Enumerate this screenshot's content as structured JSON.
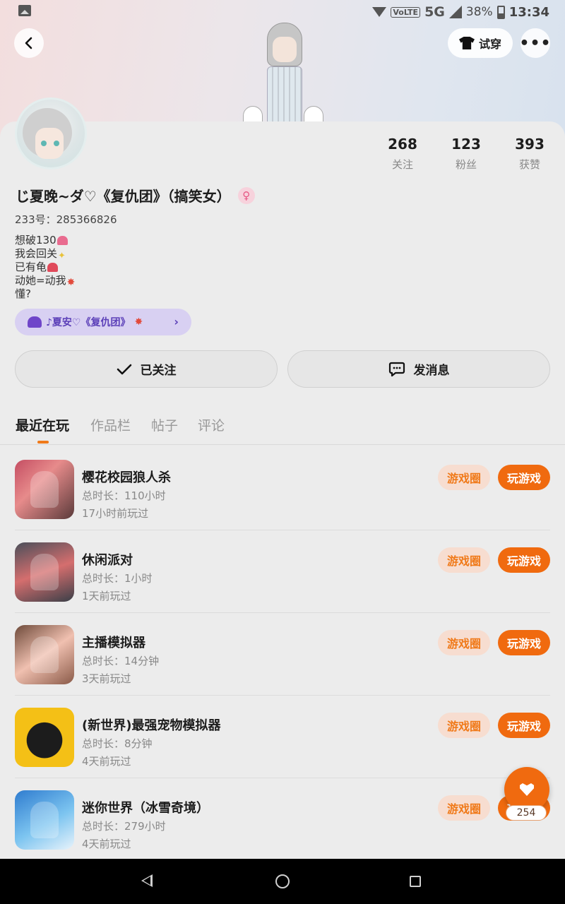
{
  "status_bar": {
    "network": "5G",
    "volte": "VoLTE",
    "battery": "38%",
    "time": "13:34"
  },
  "header": {
    "tryon_label": "试穿",
    "more_label": "•••"
  },
  "profile": {
    "stats": [
      {
        "value": "268",
        "label": "关注"
      },
      {
        "value": "123",
        "label": "粉丝"
      },
      {
        "value": "393",
        "label": "获赞"
      }
    ],
    "name": "じ夏晚~ダ♡《复仇团》（搞笑女）",
    "gender_icon": "female-icon",
    "uid": "233号：285366826",
    "bio_lines": [
      "想破130",
      "我会回关",
      "已有龟",
      "动她=动我",
      "懂?"
    ],
    "fan_badge": "♪夏安♡《复仇团》",
    "follow_label": "已关注",
    "message_label": "发消息"
  },
  "tabs": [
    {
      "label": "最近在玩",
      "active": true
    },
    {
      "label": "作品栏",
      "active": false
    },
    {
      "label": "帖子",
      "active": false
    },
    {
      "label": "评论",
      "active": false
    }
  ],
  "games": [
    {
      "title": "樱花校园狼人杀",
      "duration": "总时长：110小时",
      "last_played": "17小时前玩过",
      "circle_label": "游戏圈",
      "play_label": "玩游戏"
    },
    {
      "title": "休闲派对",
      "duration": "总时长：1小时",
      "last_played": "1天前玩过",
      "circle_label": "游戏圈",
      "play_label": "玩游戏"
    },
    {
      "title": "主播模拟器",
      "duration": "总时长：14分钟",
      "last_played": "3天前玩过",
      "circle_label": "游戏圈",
      "play_label": "玩游戏"
    },
    {
      "title": "(新世界)最强宠物模拟器",
      "duration": "总时长：8分钟",
      "last_played": "4天前玩过",
      "circle_label": "游戏圈",
      "play_label": "玩游戏"
    },
    {
      "title": "迷你世界（冰雪奇境）",
      "duration": "总时长：279小时",
      "last_played": "4天前玩过",
      "circle_label": "游戏圈",
      "play_label": "玩游戏"
    }
  ],
  "like_fab": {
    "count": "254"
  },
  "colors": {
    "accent": "#f06a0f",
    "accent_light": "#f7ddd0",
    "badge_purple": "#d8d0f2"
  }
}
